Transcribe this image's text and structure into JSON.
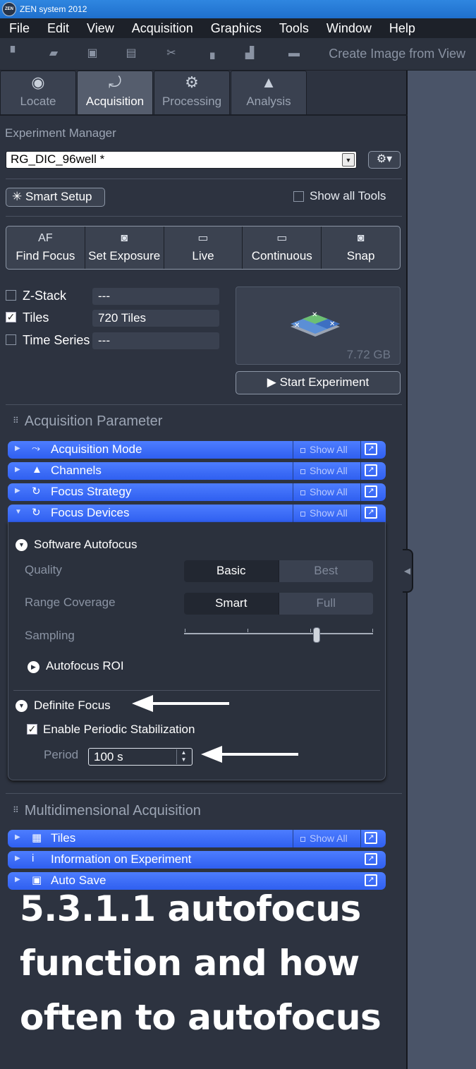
{
  "window": {
    "title": "ZEN system 2012",
    "logo_text": "ZEN"
  },
  "menubar": [
    "File",
    "Edit",
    "View",
    "Acquisition",
    "Graphics",
    "Tools",
    "Window",
    "Help"
  ],
  "toolbar": {
    "icons": [
      "new-file-icon",
      "open-folder-icon",
      "save-icon",
      "inspect-icon",
      "cut-icon",
      "copy-icon",
      "paste-icon",
      "ruler-icon"
    ],
    "create_image_label": "Create Image from View"
  },
  "main_tabs": [
    {
      "label": "Locate",
      "icon": "eye-icon",
      "active": false
    },
    {
      "label": "Acquisition",
      "icon": "acquisition-icon",
      "active": true
    },
    {
      "label": "Processing",
      "icon": "gear-icon",
      "active": false
    },
    {
      "label": "Analysis",
      "icon": "histogram-icon",
      "active": false
    }
  ],
  "experiment_manager": {
    "title": "Experiment Manager",
    "experiment": "RG_DIC_96well *",
    "smart_setup_label": "Smart Setup",
    "show_all_tools_label": "Show all Tools",
    "show_all_tools_checked": false
  },
  "acquisition_buttons": [
    {
      "icon_text": "AF",
      "label": "Find Focus"
    },
    {
      "icon_text": "",
      "label": "Set Exposure",
      "icon": "camera-icon"
    },
    {
      "icon_text": "",
      "label": "Live",
      "icon": "video-icon"
    },
    {
      "icon_text": "",
      "label": "Continuous",
      "icon": "video-icon"
    },
    {
      "icon_text": "",
      "label": "Snap",
      "icon": "camera-icon"
    }
  ],
  "dimensions": [
    {
      "label": "Z-Stack",
      "checked": false,
      "value": "---"
    },
    {
      "label": "Tiles",
      "checked": true,
      "value": "720 Tiles"
    },
    {
      "label": "Time Series",
      "checked": false,
      "value": "---"
    }
  ],
  "preview": {
    "size": "7.72 GB"
  },
  "start_experiment_label": "Start Experiment",
  "acquisition_parameter": {
    "title": "Acquisition Parameter",
    "tools": [
      {
        "name": "Acquisition Mode",
        "icon": "acq-mode-icon",
        "show_all": "Show All"
      },
      {
        "name": "Channels",
        "icon": "channels-icon",
        "show_all": "Show All"
      },
      {
        "name": "Focus Strategy",
        "icon": "focus-strategy-icon",
        "show_all": "Show All"
      },
      {
        "name": "Focus Devices",
        "icon": "focus-devices-icon",
        "show_all": "Show All",
        "expanded": true
      }
    ]
  },
  "focus_devices": {
    "software_autofocus": "Software Autofocus",
    "quality_label": "Quality",
    "quality_options": [
      "Basic",
      "Best"
    ],
    "quality_selected": "Basic",
    "range_label": "Range Coverage",
    "range_options": [
      "Smart",
      "Full"
    ],
    "range_selected": "Smart",
    "sampling_label": "Sampling",
    "sampling_level": 0.7,
    "autofocus_roi": "Autofocus ROI",
    "definite_focus": "Definite Focus",
    "enable_periodic_label": "Enable Periodic Stabilization",
    "enable_periodic_checked": true,
    "period_label": "Period",
    "period_value": "100 s"
  },
  "multidimensional": {
    "title": "Multidimensional Acquisition",
    "tools": [
      {
        "name": "Tiles",
        "icon": "tiles-icon",
        "show_all": "Show All"
      },
      {
        "name": "Information on Experiment",
        "icon": "info-icon",
        "show_all": ""
      },
      {
        "name": "Auto Save",
        "icon": "save-icon",
        "show_all": ""
      }
    ]
  },
  "caption": "5.3.1.1 autofocus function and how often to autofocus"
}
